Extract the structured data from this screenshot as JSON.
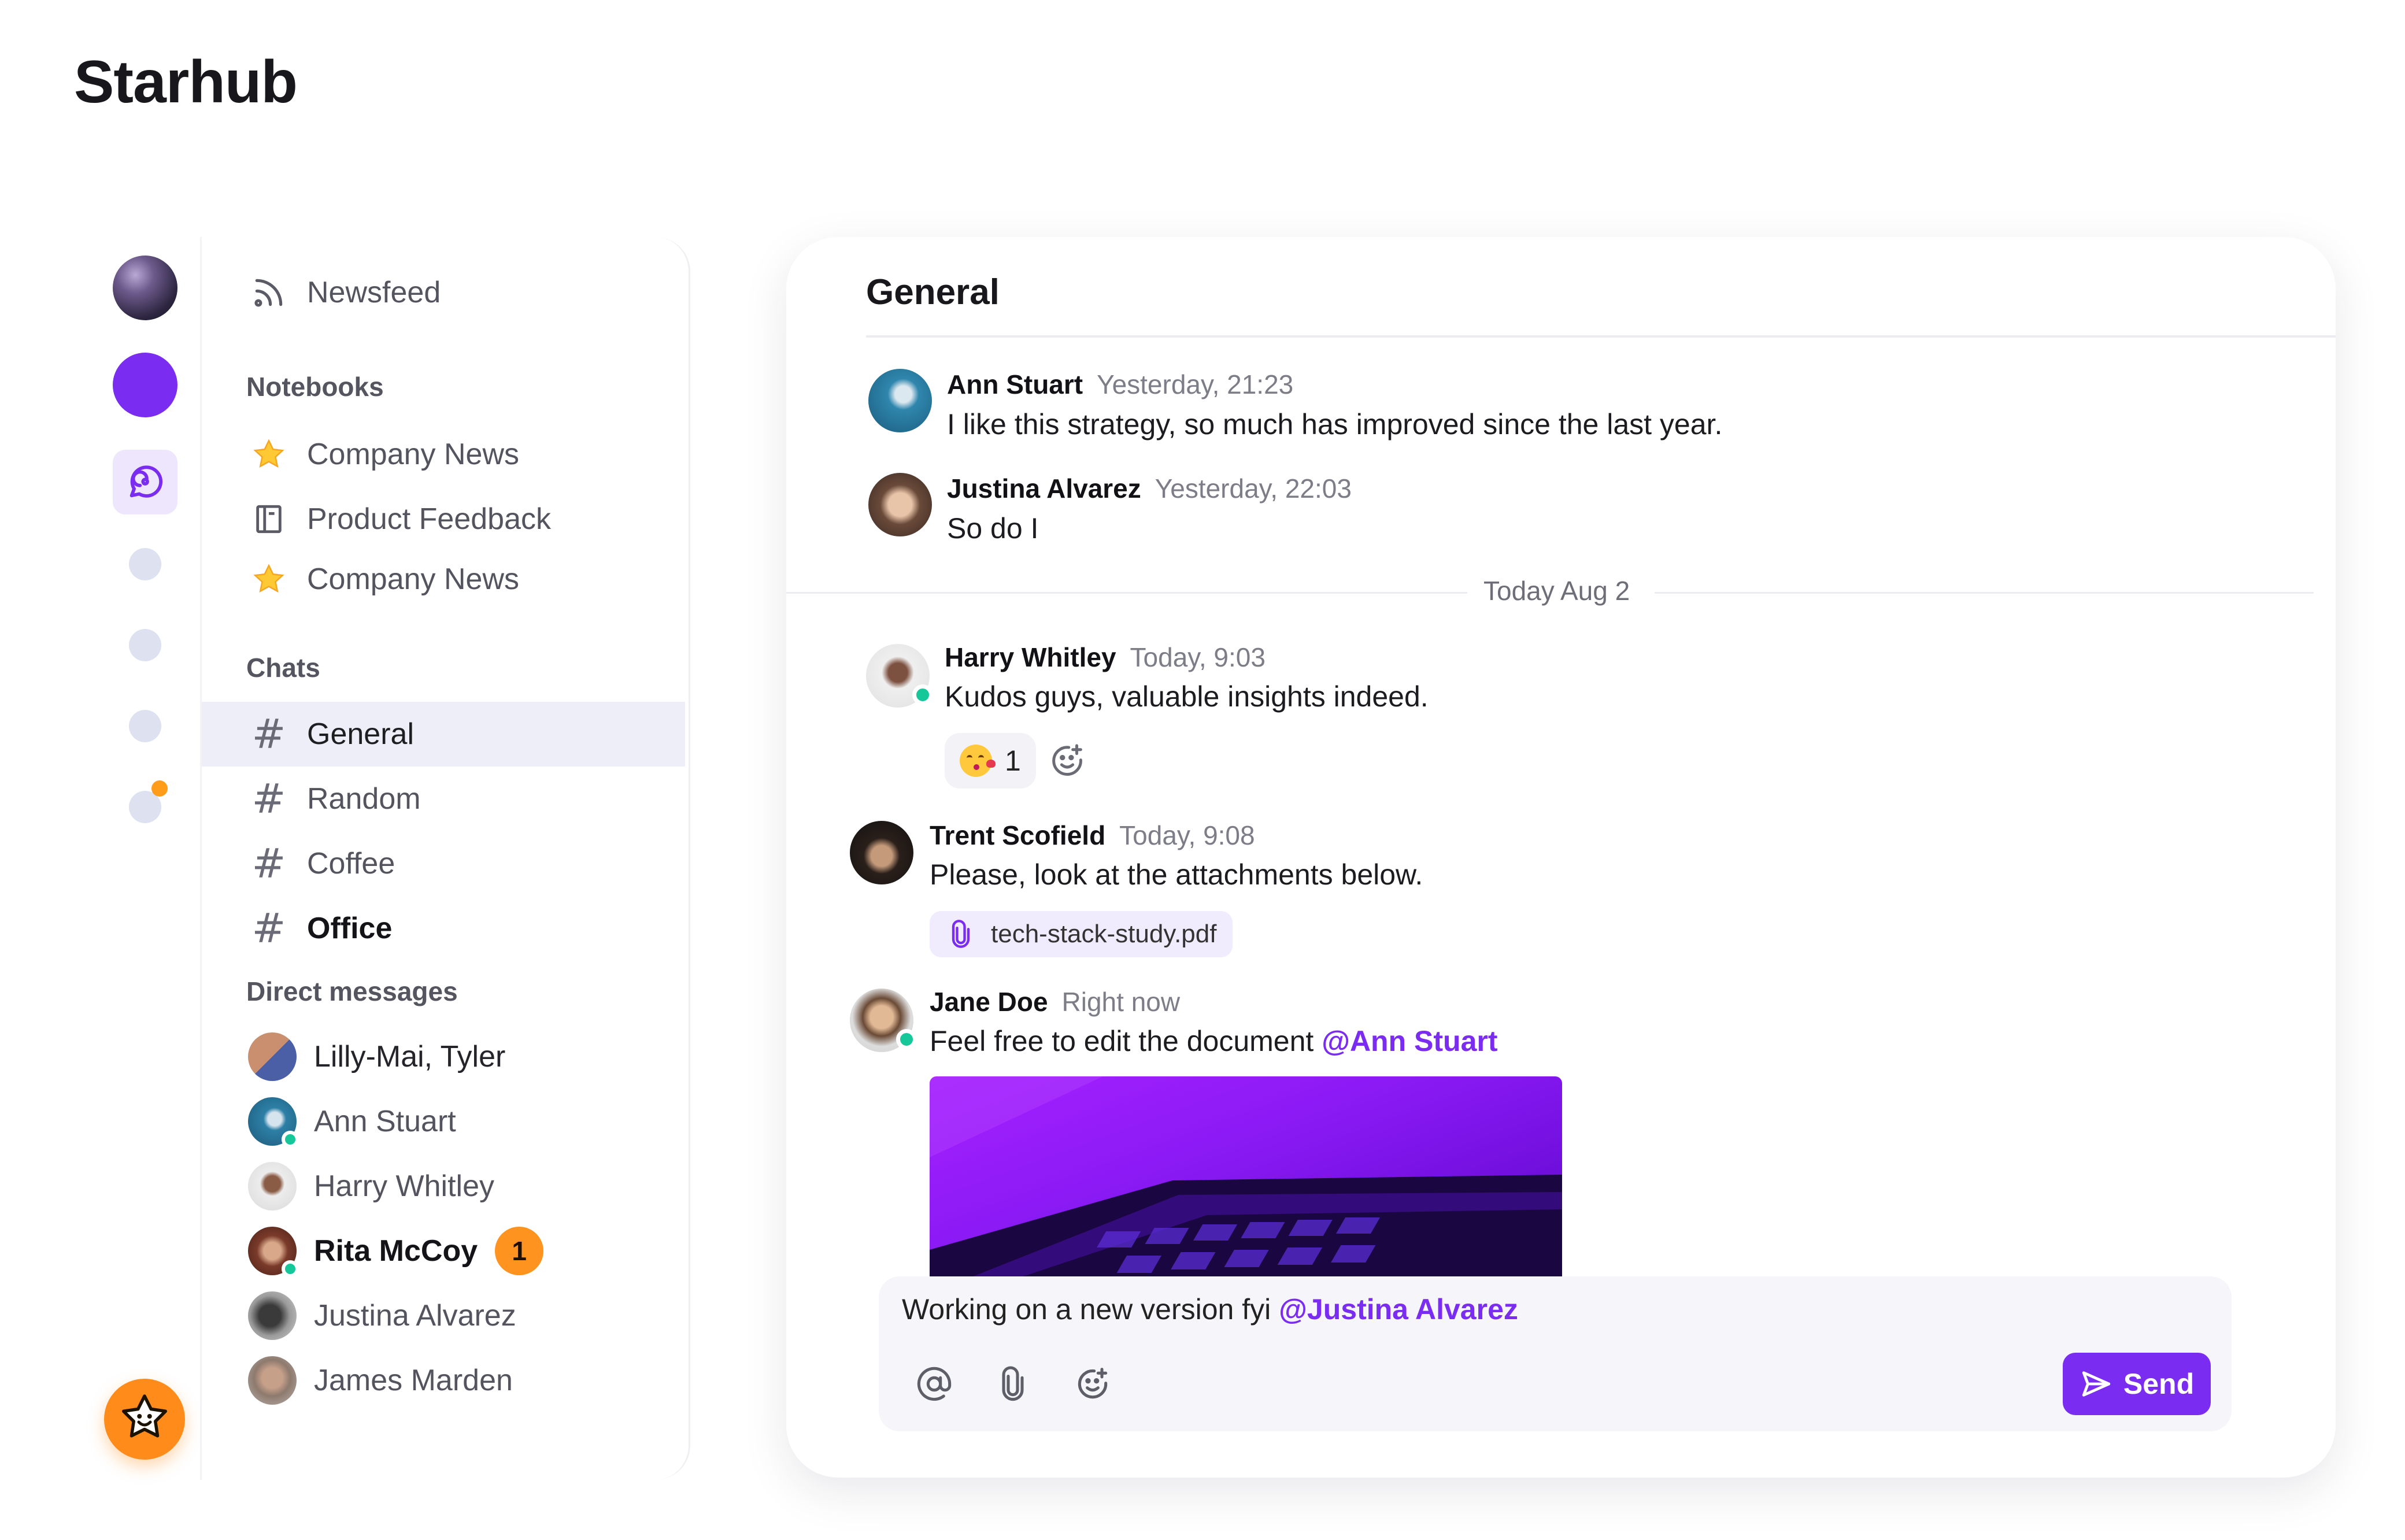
{
  "app": {
    "title": "Starhub"
  },
  "sidebar": {
    "newsfeed": "Newsfeed",
    "notebooks_heading": "Notebooks",
    "notebooks": [
      {
        "label": "Company News",
        "icon": "star-icon"
      },
      {
        "label": "Product Feedback",
        "icon": "notebook-icon"
      },
      {
        "label": "Company News",
        "icon": "star-icon"
      }
    ],
    "chats_heading": "Chats",
    "chats": [
      {
        "label": "General",
        "active": true
      },
      {
        "label": "Random"
      },
      {
        "label": "Coffee"
      },
      {
        "label": "Office",
        "bold": true
      }
    ],
    "dm_heading": "Direct messages",
    "dms": [
      {
        "label": "Lilly-Mai, Tyler"
      },
      {
        "label": "Ann Stuart",
        "online": true
      },
      {
        "label": "Harry Whitley"
      },
      {
        "label": "Rita McCoy",
        "online": true,
        "unread": "1",
        "bold": true
      },
      {
        "label": "Justina Alvarez"
      },
      {
        "label": "James Marden"
      }
    ]
  },
  "chat": {
    "title": "General",
    "divider": "Today Aug 2",
    "messages": [
      {
        "author": "Ann Stuart",
        "time": "Yesterday, 21:23",
        "text": "I like this strategy, so much has improved since the last year."
      },
      {
        "author": "Justina Alvarez",
        "time": "Yesterday, 22:03",
        "text": "So do I"
      },
      {
        "author": "Harry Whitley",
        "time": "Today, 9:03",
        "text": "Kudos guys, valuable insights indeed.",
        "reaction_count": "1"
      },
      {
        "author": "Trent Scofield",
        "time": "Today, 9:08",
        "text": "Please, look at the attachments below.",
        "attachment": "tech-stack-study.pdf"
      },
      {
        "author": "Jane Doe",
        "time": "Right now",
        "text": "Feel free to edit the document ",
        "mention": "@Ann Stuart"
      }
    ],
    "composer": {
      "text": "Working on a new version fyi ",
      "mention": "@Justina Alvarez",
      "send_label": "Send"
    }
  },
  "colors": {
    "accent": "#7a2cf0",
    "online": "#16c79a",
    "badge": "#ff931f"
  }
}
